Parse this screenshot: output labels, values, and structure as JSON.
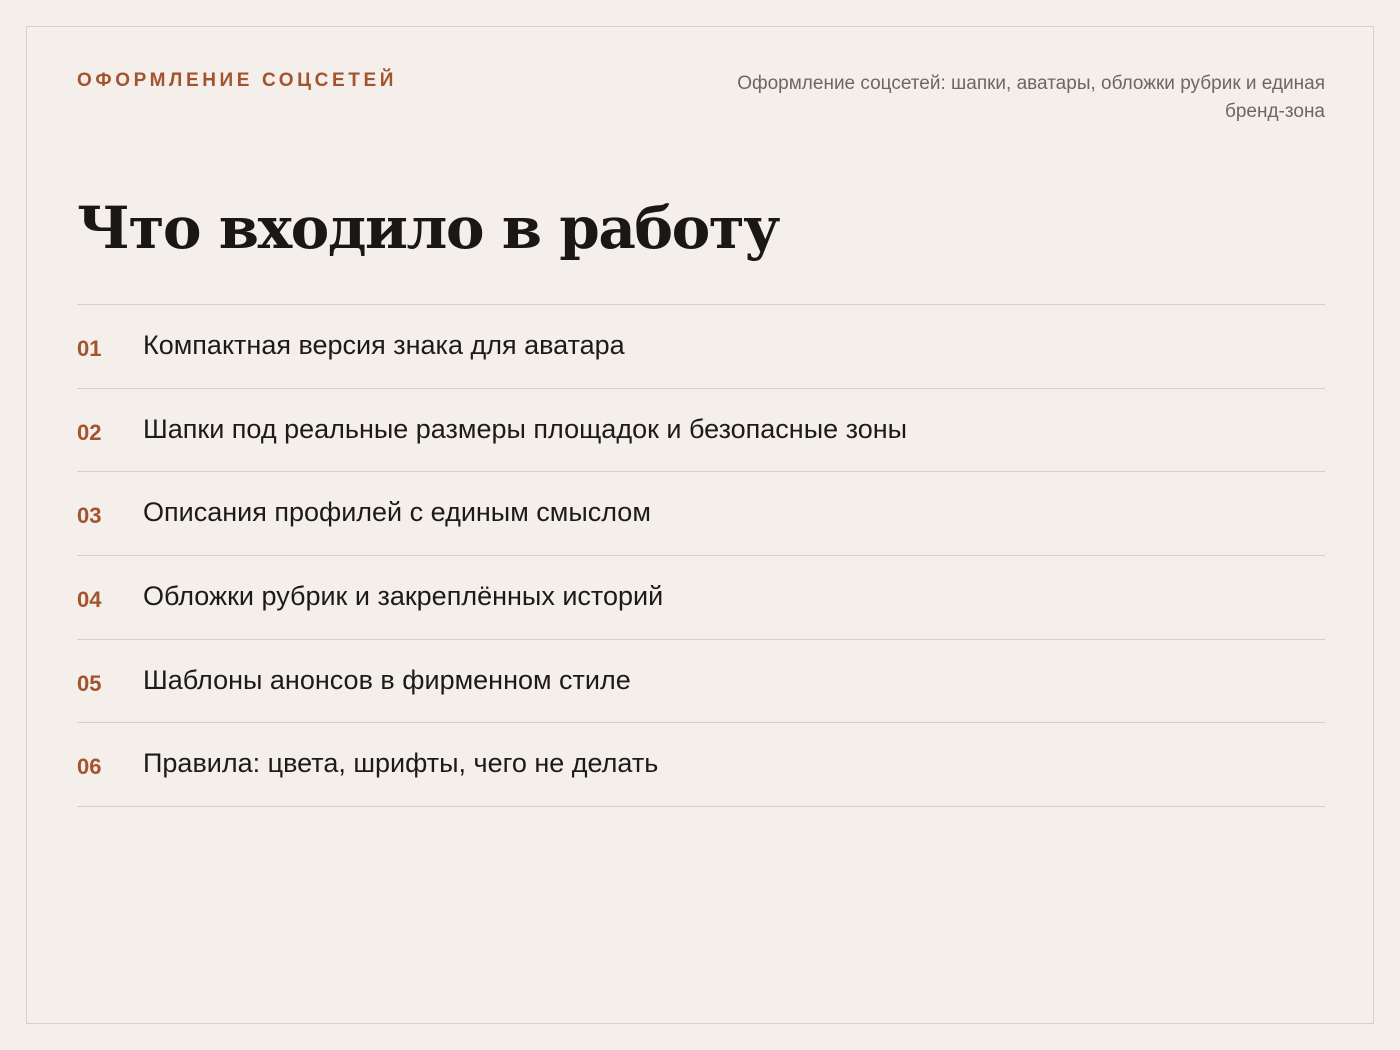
{
  "header": {
    "eyebrow": "ОФОРМЛЕНИЕ СОЦСЕТЕЙ",
    "subtitle": "Оформление соцсетей: шапки, аватары, обложки рубрик и единая бренд-зона"
  },
  "main": {
    "title": "Что входило в работу",
    "items": [
      {
        "num": "01",
        "text": "Компактная версия знака для аватара"
      },
      {
        "num": "02",
        "text": "Шапки под реальные размеры площадок и безопасные зоны"
      },
      {
        "num": "03",
        "text": "Описания профилей с единым смыслом"
      },
      {
        "num": "04",
        "text": "Обложки рубрик и закреплённых историй"
      },
      {
        "num": "05",
        "text": "Шаблоны анонсов в фирменном стиле"
      },
      {
        "num": "06",
        "text": "Правила: цвета, шрифты, чего не делать"
      }
    ]
  },
  "colors": {
    "background": "#f4efea",
    "accent": "#a4532f",
    "text": "#1d1b19",
    "muted": "#6d6761",
    "rule": "#d6cfc7"
  }
}
